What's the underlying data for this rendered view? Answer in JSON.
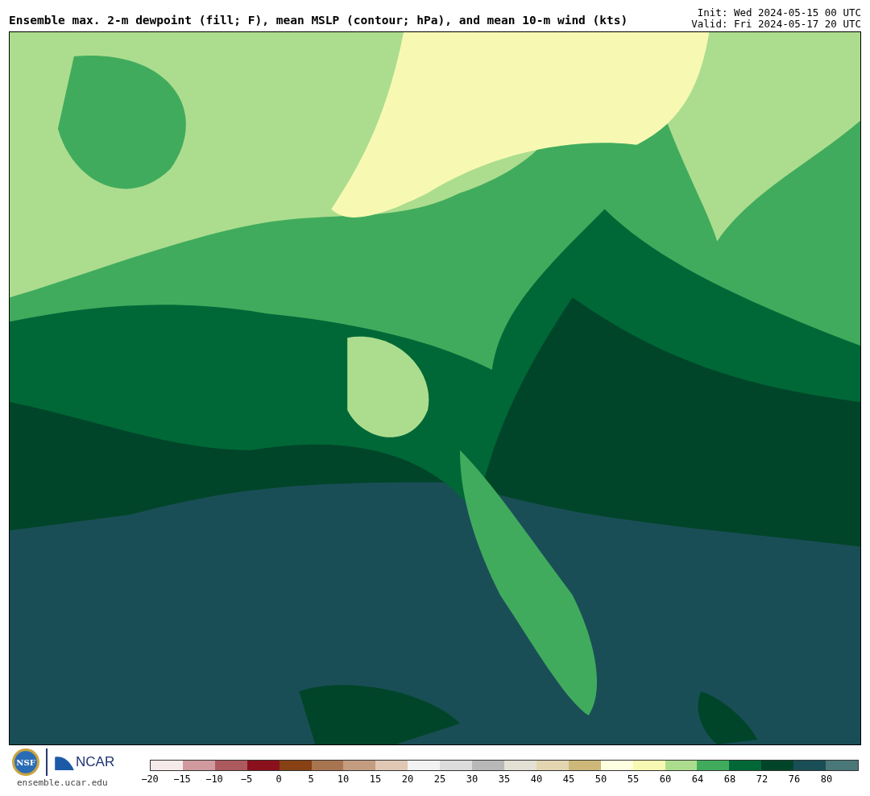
{
  "title": "Ensemble max. 2-m dewpoint (fill; F), mean MSLP (contour; hPa), and mean 10-m wind (kts)",
  "init": "Init: Wed 2024-05-15 00 UTC",
  "valid": "Valid: Fri 2024-05-17 20 UTC",
  "footer": {
    "nsf_logo": "NSF",
    "ncar_logo": "NCAR",
    "site": "ensemble.ucar.edu"
  },
  "colorbar": {
    "segments": [
      {
        "color": "#f5e9e9"
      },
      {
        "color": "#d19a9e"
      },
      {
        "color": "#ad5a5f"
      },
      {
        "color": "#8a111c"
      },
      {
        "color": "#874113"
      },
      {
        "color": "#a87551"
      },
      {
        "color": "#c49d80"
      },
      {
        "color": "#e0c8b4"
      },
      {
        "color": "#f2f2f2"
      },
      {
        "color": "#dcdcdc"
      },
      {
        "color": "#b8b8b8"
      },
      {
        "color": "#e3e1d4"
      },
      {
        "color": "#e3d5b0"
      },
      {
        "color": "#cdb87a"
      },
      {
        "color": "#fefee0"
      },
      {
        "color": "#f7f9b2"
      },
      {
        "color": "#acdd8e"
      },
      {
        "color": "#41ab5d"
      },
      {
        "color": "#006837"
      },
      {
        "color": "#004529"
      },
      {
        "color": "#1a4e56"
      },
      {
        "color": "#4a7778"
      }
    ],
    "ticks": [
      "−20",
      "−15",
      "−10",
      "−5",
      "0",
      "5",
      "10",
      "15",
      "20",
      "25",
      "30",
      "35",
      "40",
      "45",
      "50",
      "55",
      "60",
      "64",
      "68",
      "72",
      "76",
      "80"
    ]
  }
}
